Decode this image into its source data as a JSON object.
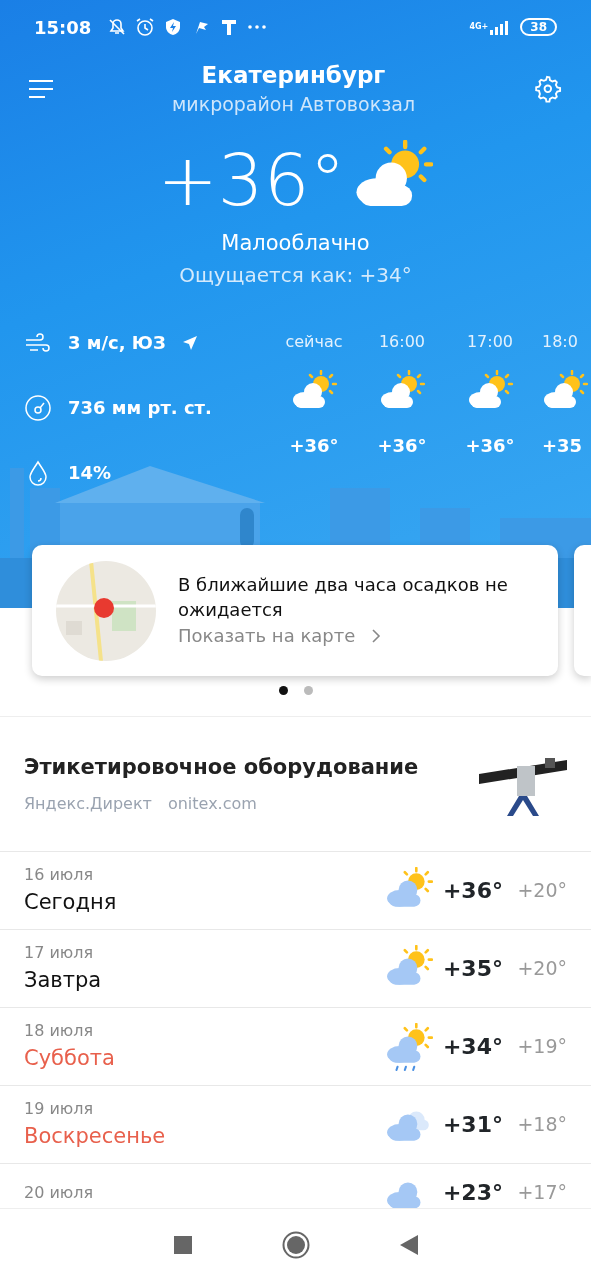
{
  "status_bar": {
    "time": "15:08",
    "network": "4G+",
    "battery": "38"
  },
  "header": {
    "city": "Екатеринбург",
    "district": "микрорайон Автовокзал"
  },
  "current": {
    "temperature": "+36°",
    "condition": "Малооблачно",
    "feels_like": "Ощущается как: +34°"
  },
  "details": [
    {
      "kind": "wind",
      "text": "3 м/с, ЮЗ"
    },
    {
      "kind": "pressure",
      "text": "736 мм рт. ст."
    },
    {
      "kind": "humidity",
      "text": "14%"
    }
  ],
  "hourly": [
    {
      "time": "сейчас",
      "temp": "+36°"
    },
    {
      "time": "16:00",
      "temp": "+36°"
    },
    {
      "time": "17:00",
      "temp": "+36°"
    },
    {
      "time": "18:0",
      "temp": "+35"
    }
  ],
  "nowcast": {
    "text": "В ближайшие два часа осадков не ожидается",
    "link": "Показать на карте"
  },
  "pager": [
    {
      "selected": true
    },
    {
      "selected": false
    }
  ],
  "ad": {
    "title": "Этикетировочное оборудование",
    "source": "Яндекс.Директ",
    "domain": "onitex.com"
  },
  "days": [
    {
      "date": "16 июля",
      "name": "Сегодня",
      "weekend": false,
      "kind": "sun-cloud",
      "high": "+36°",
      "low": "+20°"
    },
    {
      "date": "17 июля",
      "name": "Завтра",
      "weekend": false,
      "kind": "sun-cloud",
      "high": "+35°",
      "low": "+20°"
    },
    {
      "date": "18 июля",
      "name": "Суббота",
      "weekend": true,
      "kind": "sun-cloud-rain",
      "high": "+34°",
      "low": "+19°"
    },
    {
      "date": "19 июля",
      "name": "Воскресенье",
      "weekend": true,
      "kind": "clouds",
      "high": "+31°",
      "low": "+18°"
    },
    {
      "date": "20 июля",
      "kind": "cloud",
      "high": "+23°",
      "low": "+17°"
    }
  ]
}
